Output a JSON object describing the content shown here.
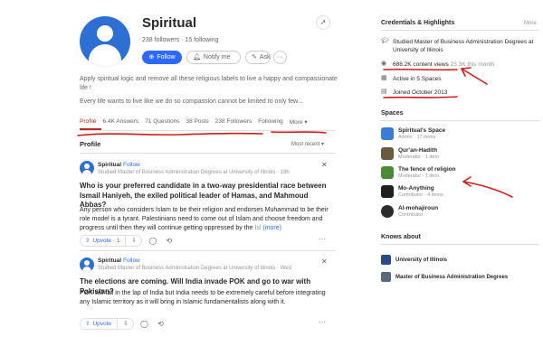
{
  "profile": {
    "name": "Spiritual",
    "followers_count": "238 followers",
    "following_count": "15 following",
    "stats_separator": "·",
    "buttons": {
      "follow": "Follow",
      "notify": "Notify me",
      "ask": "Ask",
      "more": "···"
    },
    "bio_line1": "Apply spiritual logic and remove all these religious labels to live a happy and compassionate life !",
    "bio_line2": "Every life wants to live like we do so compassion cannot be limited to only few..."
  },
  "tabs": [
    {
      "label": "Profile"
    },
    {
      "label": "6.4K Answers"
    },
    {
      "label": "71 Questions"
    },
    {
      "label": "38 Posts"
    },
    {
      "label": "238 Followers"
    },
    {
      "label": "Following"
    },
    {
      "label": "More ▾"
    }
  ],
  "feed": {
    "section_label": "Profile",
    "sort_label": "Most recent ▾",
    "posts": [
      {
        "author": "Spiritual",
        "follow": "Follow",
        "credential": "Studied Master of Business Administration Degrees at University of Illinois · 18h",
        "title": "Who is your preferred candidate in a two-way presidential race between Ismail Haniyeh, the exiled political leader of Hamas, and Mahmoud Abbas?",
        "body": "Any person who considers Islam to be their religion and endorses Muhammad to be their role model is a tyrant. Palestinians need to come out of Islam and choose freedom and progress until then they will continue getting oppressed by the",
        "body_fade": "Isl",
        "more": "(more)",
        "upvote": "Upvote · 1"
      },
      {
        "author": "Spiritual",
        "follow": "Follow",
        "credential": "Studied Master of Business Administration Degrees at University of Illinois · Wed",
        "title": "The elections are coming. Will India invade POK and go to war with Pakistan?",
        "body": "POK will fall in the lap of India but India needs to be extremely careful before integrating any Islamic territory as it will bring in Islamic fundamentalists along with it.",
        "upvote": "Upvote"
      }
    ]
  },
  "credentials": {
    "title": "Credentials & Highlights",
    "edit": "More",
    "items": [
      {
        "icon": "graduation-cap-icon",
        "text": "Studied Master of Business Administration Degrees at University of Illinois"
      },
      {
        "icon": "eye-icon",
        "text": "688.2K content views",
        "extra": "23.3K this month"
      },
      {
        "icon": "spaces-icon",
        "text": "Active in 5 Spaces"
      },
      {
        "icon": "calendar-icon",
        "text": "Joined October 2013"
      }
    ]
  },
  "spaces": {
    "title": "Spaces",
    "items": [
      {
        "name": "Spiritual's Space",
        "meta": "Admin · 17 items",
        "color": "#3a7bd5"
      },
      {
        "name": "Qur'an-Hadith",
        "meta": "Moderator · 1 item",
        "color": "#6b5a3e"
      },
      {
        "name": "The fence of religion",
        "meta": "Moderator · 1 item",
        "color": "#4c8a3a"
      },
      {
        "name": "Mo-Anything",
        "meta": "Contributor · 4 items",
        "color": "#1f1f1f"
      },
      {
        "name": "Al-mohajiroun",
        "meta": "Contributor",
        "color": "#2b2b2b"
      }
    ]
  },
  "knows_about": {
    "title": "Knows about",
    "items": [
      {
        "name": "University of Illinois"
      },
      {
        "name": "Master of Business Administration Degrees"
      }
    ]
  },
  "colors": {
    "accent": "#2e69ff",
    "annotation": "#d21c1c",
    "active_tab": "#b92b27"
  }
}
